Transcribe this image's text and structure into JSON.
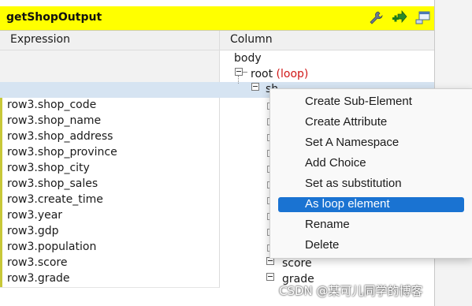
{
  "panel": {
    "title": "getShopOutput",
    "toolbar_icons": [
      "wrench-icon",
      "add-arrow-icon",
      "window-icon"
    ]
  },
  "columns": {
    "expression": "Expression",
    "column": "Column"
  },
  "tree": {
    "body": "body",
    "root": "root",
    "root_loop": "(loop)",
    "child_partial": "sh",
    "score": "score",
    "grade": "grade"
  },
  "expressions": [
    "row3.shop_code",
    "row3.shop_name",
    "row3.shop_address",
    "row3.shop_province",
    "row3.shop_city",
    "row3.shop_sales",
    "row3.create_time",
    "row3.year",
    "row3.gdp",
    "row3.population",
    "row3.score",
    "row3.grade"
  ],
  "context_menu": {
    "items": [
      "Create Sub-Element",
      "Create Attribute",
      "Set A Namespace",
      "Add Choice",
      "Set as substitution",
      "As loop element",
      "Rename",
      "Delete"
    ],
    "selected": "As loop element"
  },
  "watermark": "CSDN @某可儿同学的博客",
  "colors": {
    "title_bar": "#ffff00",
    "selected_row": "#d6e4f2",
    "menu_highlight": "#1a73d2",
    "loop_text": "#d01818"
  }
}
